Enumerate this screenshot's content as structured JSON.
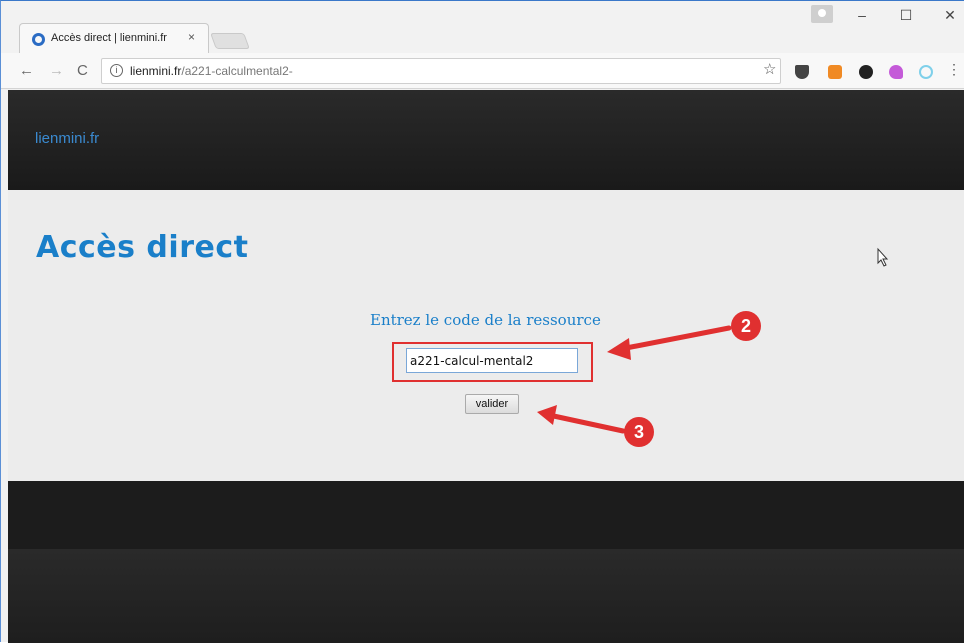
{
  "browser": {
    "tab_title": "Accès direct | lienmini.fr",
    "tab_close": "×",
    "url_host": "lienmini.fr",
    "url_path": "/a221-calculmental2-",
    "info_glyph": "i",
    "star_glyph": "☆",
    "menu_glyph": "⋮",
    "back_glyph": "←",
    "forward_glyph": "→",
    "reload_glyph": "C",
    "min_glyph": "–",
    "max_glyph": "☐",
    "close_glyph": "✕",
    "accent_color": "#3a78c9"
  },
  "site": {
    "logo": "lienmini.fr",
    "page_title": "Accès direct",
    "form_label": "Entrez le code de la ressource",
    "code_value": "a221-calcul-mental2",
    "submit_label": "valider",
    "title_color": "#1a7fc9"
  },
  "annotations": {
    "badge_2": "2",
    "badge_3": "3",
    "arrow_color": "#e03030"
  }
}
